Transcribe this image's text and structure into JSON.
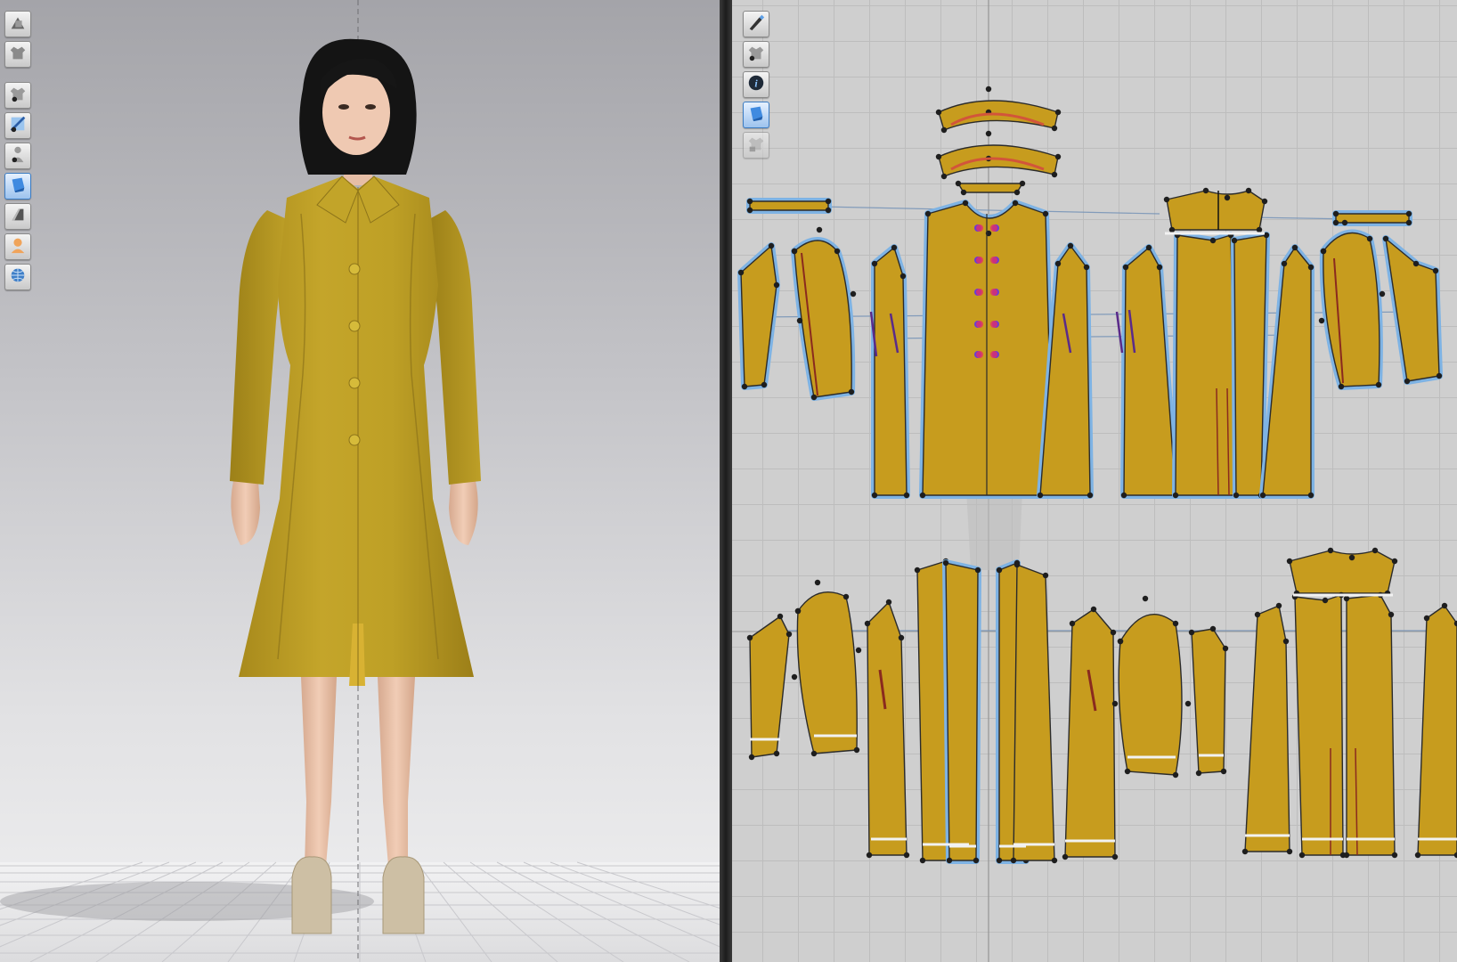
{
  "app": {
    "accent": "#3c7cc2",
    "garment_color": "#c79c1e",
    "outline_color": "#7eb3e4"
  },
  "viewport3d": {
    "toolbar": [
      {
        "id": "display-avatar",
        "icon": "avatar-display-icon",
        "active": false
      },
      {
        "id": "display-garment",
        "icon": "garment-display-icon",
        "active": false
      },
      {
        "id": "gap"
      },
      {
        "id": "show-garment",
        "icon": "show-garment-icon",
        "active": false
      },
      {
        "id": "texture-surface",
        "icon": "texture-surface-icon",
        "active": false
      },
      {
        "id": "show-avatar",
        "icon": "show-avatar-icon",
        "active": false
      },
      {
        "id": "fabric-mode",
        "icon": "fabric-mode-icon",
        "active": true
      },
      {
        "id": "thickness",
        "icon": "thickness-icon",
        "active": false
      },
      {
        "id": "skin",
        "icon": "skin-icon",
        "active": false
      },
      {
        "id": "environment",
        "icon": "globe-icon",
        "active": false
      }
    ]
  },
  "viewport2d": {
    "toolbar": [
      {
        "id": "pattern-edit",
        "icon": "pattern-pen-icon",
        "active": false
      },
      {
        "id": "show-garment-2d",
        "icon": "garment-eye-icon",
        "active": false
      },
      {
        "id": "pattern-info",
        "icon": "info-icon",
        "active": false
      },
      {
        "id": "fabric-texture",
        "icon": "fabric-texture-icon",
        "active": true
      },
      {
        "id": "lock-garment",
        "icon": "garment-lock-icon",
        "active": false,
        "disabled": true
      }
    ]
  }
}
